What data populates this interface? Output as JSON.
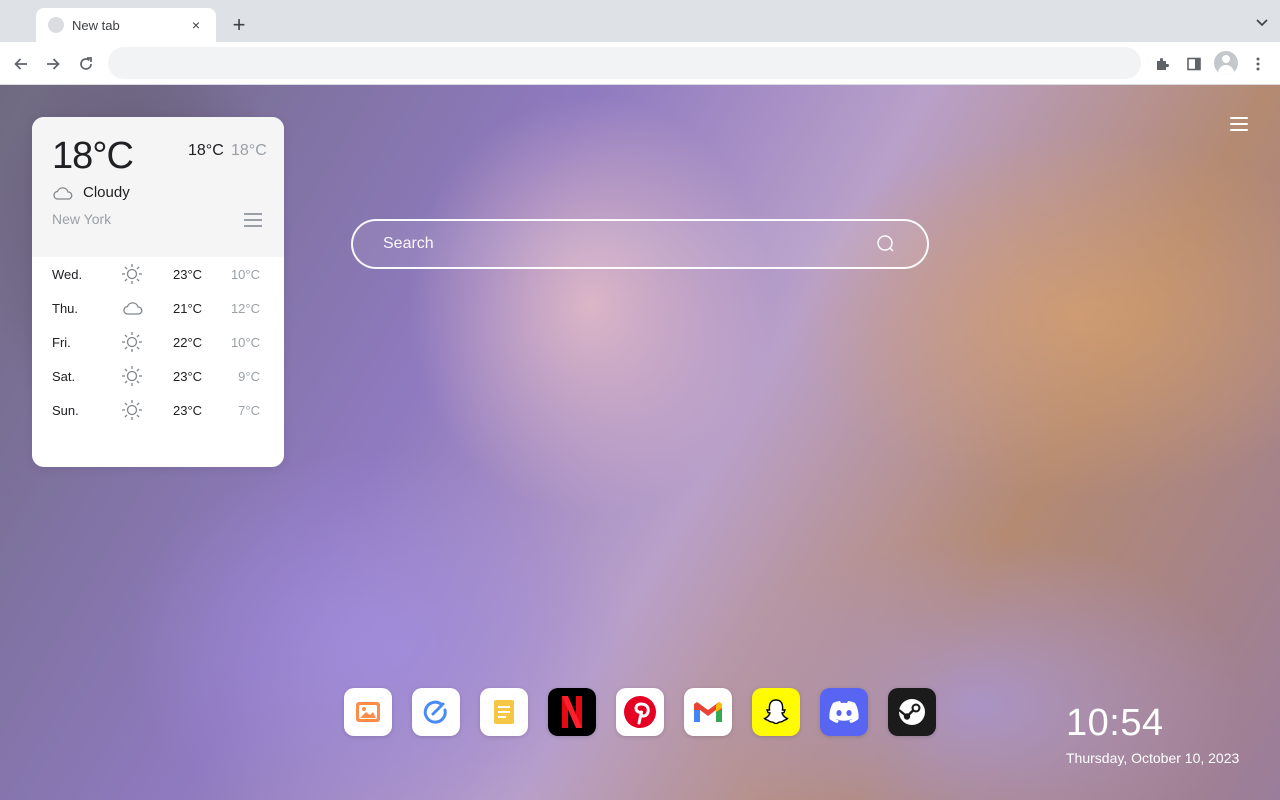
{
  "browser": {
    "tab": {
      "title": "New tab",
      "close": "×"
    },
    "new_tab": "+",
    "address": {
      "value": "",
      "placeholder": ""
    }
  },
  "weather": {
    "current_temp": "18°C",
    "high": "18°C",
    "low": "18°C",
    "condition": "Cloudy",
    "city": "New York",
    "forecast": [
      {
        "day": "Wed.",
        "icon": "sun-icon",
        "high": "23°C",
        "low": "10°C"
      },
      {
        "day": "Thu.",
        "icon": "cloud-icon",
        "high": "21°C",
        "low": "12°C"
      },
      {
        "day": "Fri.",
        "icon": "sun-icon",
        "high": "22°C",
        "low": "10°C"
      },
      {
        "day": "Sat.",
        "icon": "sun-icon",
        "high": "23°C",
        "low": "9°C"
      },
      {
        "day": "Sun.",
        "icon": "sun-icon",
        "high": "23°C",
        "low": "7°C"
      }
    ]
  },
  "search": {
    "placeholder": "Search"
  },
  "dock": {
    "apps": [
      "photos",
      "clip",
      "notes",
      "netflix",
      "pinterest",
      "gmail",
      "snapchat",
      "discord",
      "steam"
    ]
  },
  "clock": {
    "time": "10:54",
    "date": "Thursday, October 10, 2023"
  },
  "colors": {
    "netflix": "#000000",
    "netflix_red": "#e50914",
    "pinterest": "#e60023",
    "snapchat": "#fffc00",
    "discord": "#5865f2",
    "steam": "#1b1b1b"
  }
}
